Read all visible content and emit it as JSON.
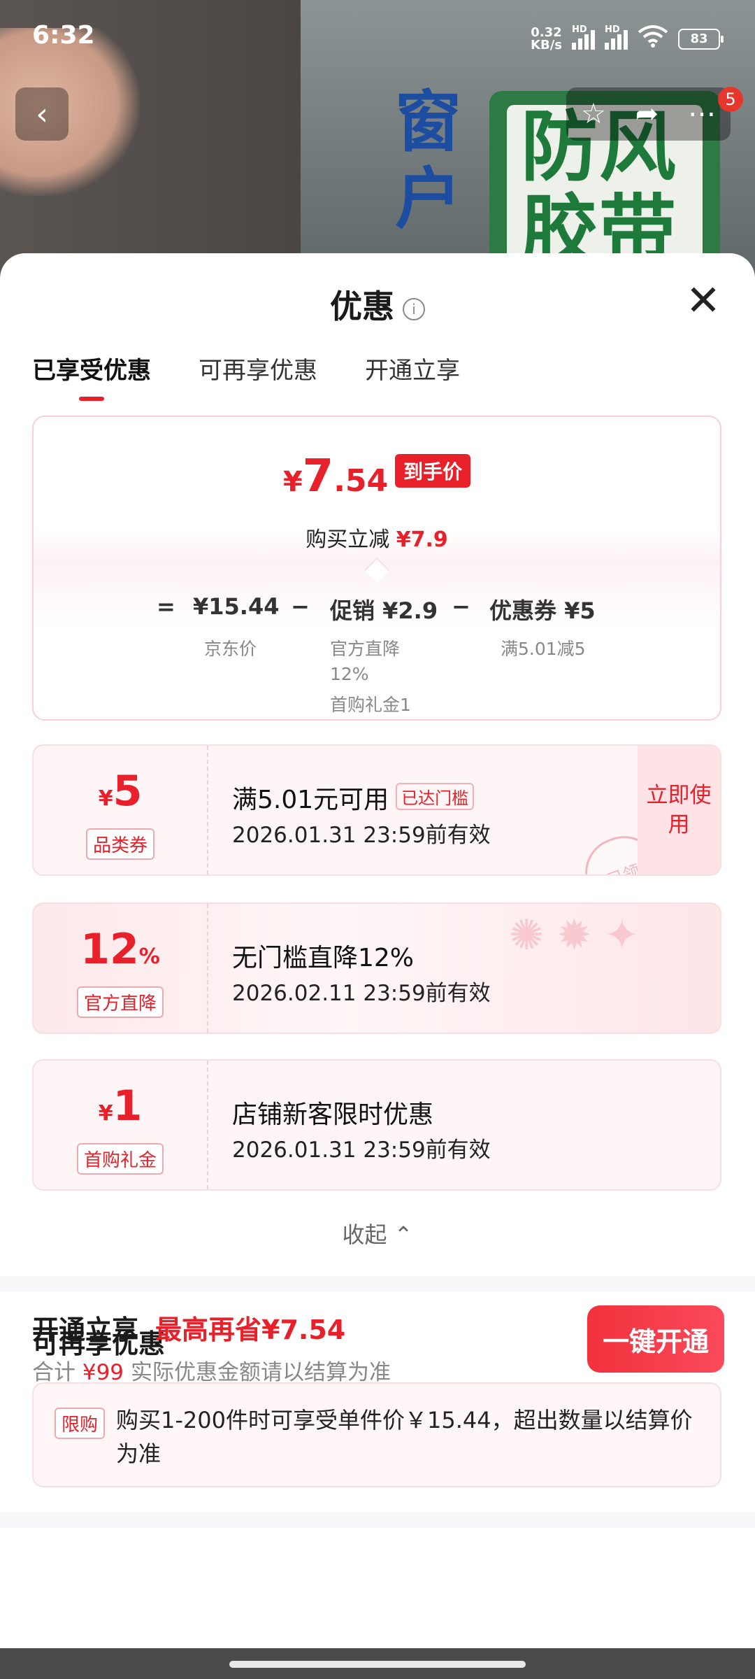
{
  "status_bar": {
    "time": "6:32",
    "net_speed_top": "0.32",
    "net_speed_bottom": "KB/s",
    "hd1": "HD",
    "hd2": "HD",
    "battery": "83"
  },
  "background": {
    "text_green": "防风胶带",
    "text_blue": "窗户"
  },
  "nav": {
    "cart_badge": "5"
  },
  "sheet": {
    "title": "优惠",
    "tabs": [
      "已享受优惠",
      "可再享优惠",
      "开通立享"
    ],
    "active_tab": 0
  },
  "summary": {
    "currency": "¥",
    "price_int": "7",
    "price_dec": ".54",
    "price_tag": "到手价",
    "reduce_label": "购买立减",
    "reduce_value": "¥7.9",
    "formula": {
      "eq": "=",
      "jd_price": "¥15.44",
      "minus1": "−",
      "promo": "促销 ¥2.9",
      "minus2": "−",
      "coupon": "优惠券 ¥5",
      "jd_label": "京东价",
      "promo_sub1": "官方直降",
      "promo_sub2": "12%",
      "promo_sub3": "首购礼金1",
      "coupon_sub": "满5.01减5"
    }
  },
  "coupons": [
    {
      "currency": "¥",
      "amount": "5",
      "tag": "品类券",
      "title": "满5.01元可用",
      "threshold": "已达门槛",
      "date": "2026.01.31 23:59前有效",
      "action": "立即使用",
      "stamp": "已领"
    },
    {
      "amount": "12",
      "suffix": "%",
      "tag": "官方直降",
      "title": "无门槛直降12%",
      "date": "2026.02.11 23:59前有效"
    },
    {
      "currency": "¥",
      "amount": "1",
      "tag": "首购礼金",
      "title": "店铺新客限时优惠",
      "date": "2026.01.31 23:59前有效"
    }
  ],
  "collapse_label": "收起 ⌃",
  "more_section": {
    "title": "可再享优惠",
    "tag": "限购",
    "text": "购买1-200件时可享受单件价￥15.44，超出数量以结算价为准"
  },
  "bottom": {
    "title": "开通立享",
    "highlight": "最高再省¥7.54",
    "total_label": "合计",
    "total_value": "¥99",
    "note": "实际优惠金额请以结算为准",
    "button": "一键开通"
  }
}
